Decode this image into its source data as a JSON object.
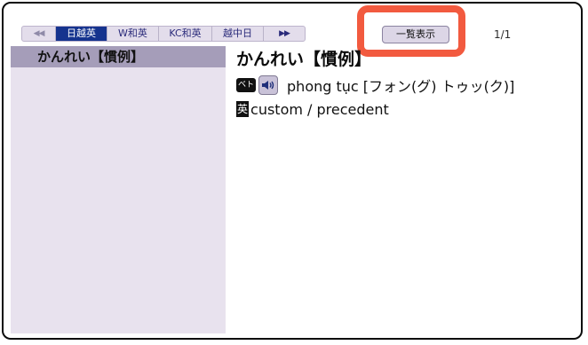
{
  "toolbar": {
    "tabs": [
      {
        "label": "◀◀"
      },
      {
        "label": "日越英"
      },
      {
        "label": "W和英"
      },
      {
        "label": "KC和英"
      },
      {
        "label": "越中日"
      },
      {
        "label": "▶▶"
      }
    ],
    "list_view_label": "一覧表示",
    "page_counter": "1/1"
  },
  "sidebar": {
    "items": [
      {
        "label": "かんれい【慣例】"
      }
    ]
  },
  "entry": {
    "headword": "かんれい【慣例】",
    "vi_badge": "ベト",
    "vietnamese": "phong tục [フォン(グ) トゥッ(ク)]",
    "en_badge": "英",
    "english": "custom / precedent"
  },
  "colors": {
    "highlight": "#f25a3f",
    "active_tab": "#15338e",
    "sidebar_bg": "#e8e2ee",
    "sidebar_selected": "#a59db9"
  }
}
